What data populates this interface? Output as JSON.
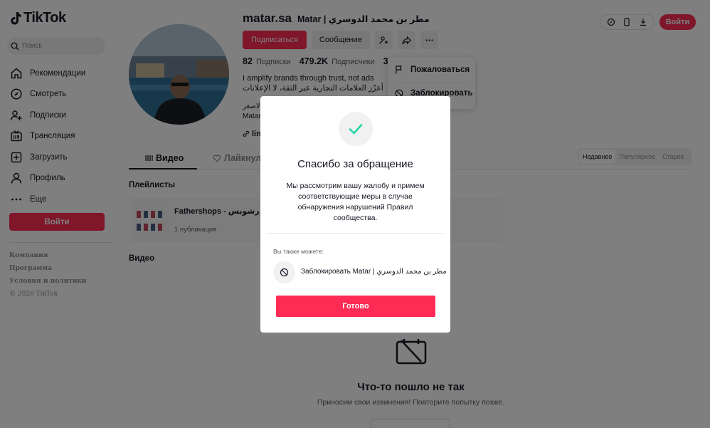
{
  "app": {
    "logo_text": "TikTok"
  },
  "search": {
    "placeholder": "Поиск"
  },
  "nav": [
    {
      "label": "Рекомендации",
      "icon": "home-icon"
    },
    {
      "label": "Смотреть",
      "icon": "compass-icon"
    },
    {
      "label": "Подписки",
      "icon": "user-plus-icon"
    },
    {
      "label": "Трансляция",
      "icon": "live-icon"
    },
    {
      "label": "Загрузить",
      "icon": "upload-icon"
    },
    {
      "label": "Профиль",
      "icon": "profile-icon"
    },
    {
      "label": "Еще",
      "icon": "more-icon"
    }
  ],
  "sidebar": {
    "login_label": "Войти",
    "footer": [
      "Компания",
      "Программа",
      "Условия и политики"
    ],
    "copyright": "© 2026 TikTok"
  },
  "header": {
    "login_label": "Войти"
  },
  "profile": {
    "handle": "matar.sa",
    "display_name": "Matar | مطر بن محمد الدوسري",
    "follow_label": "Подписаться",
    "message_label": "Сообщение",
    "stats": {
      "following_count": "82",
      "following_label": "Подписки",
      "followers_count": "479.2K",
      "followers_label": "Подписчики",
      "likes_count_partial": "3"
    },
    "bio_line1": "I amplify brands through trust, not ads",
    "bio_line2": "أعزّز العلامات التجارية عبر الثقة، لا الإعلانات",
    "bio_line3": "الاصغر",
    "bio_line4": "Matar",
    "link_partial": "lin"
  },
  "dropdown": {
    "report_label": "Пожаловаться",
    "block_label": "Заблокировать"
  },
  "tabs": {
    "videos": "Видео",
    "liked": "Лайкнул"
  },
  "sort": {
    "options": [
      "Недавнее",
      "Популярное",
      "Старое"
    ],
    "active": "Недавнее"
  },
  "playlists": {
    "section_title": "Плейлисты",
    "items": [
      {
        "title": "Fathershops - فاذرشوبس",
        "count": "1 публикация"
      }
    ]
  },
  "videos_section_title": "Видео",
  "error": {
    "title": "Что-то пошло не так",
    "subtitle": "Приносим свои извинения! Повторите попытку позже."
  },
  "modal": {
    "title": "Спасибо за обращение",
    "text": "Мы рассмотрим вашу жалобу и примем соответствующие меры в случае обнаружения нарушений Правил сообщества.",
    "also_label": "Вы также можете:",
    "block_text": "Заблокировать Matar | مطر بن محمد الدوسري",
    "done_label": "Готово"
  },
  "colors": {
    "accent": "#fe2c55",
    "check": "#20d5a7",
    "text": "#161823"
  }
}
